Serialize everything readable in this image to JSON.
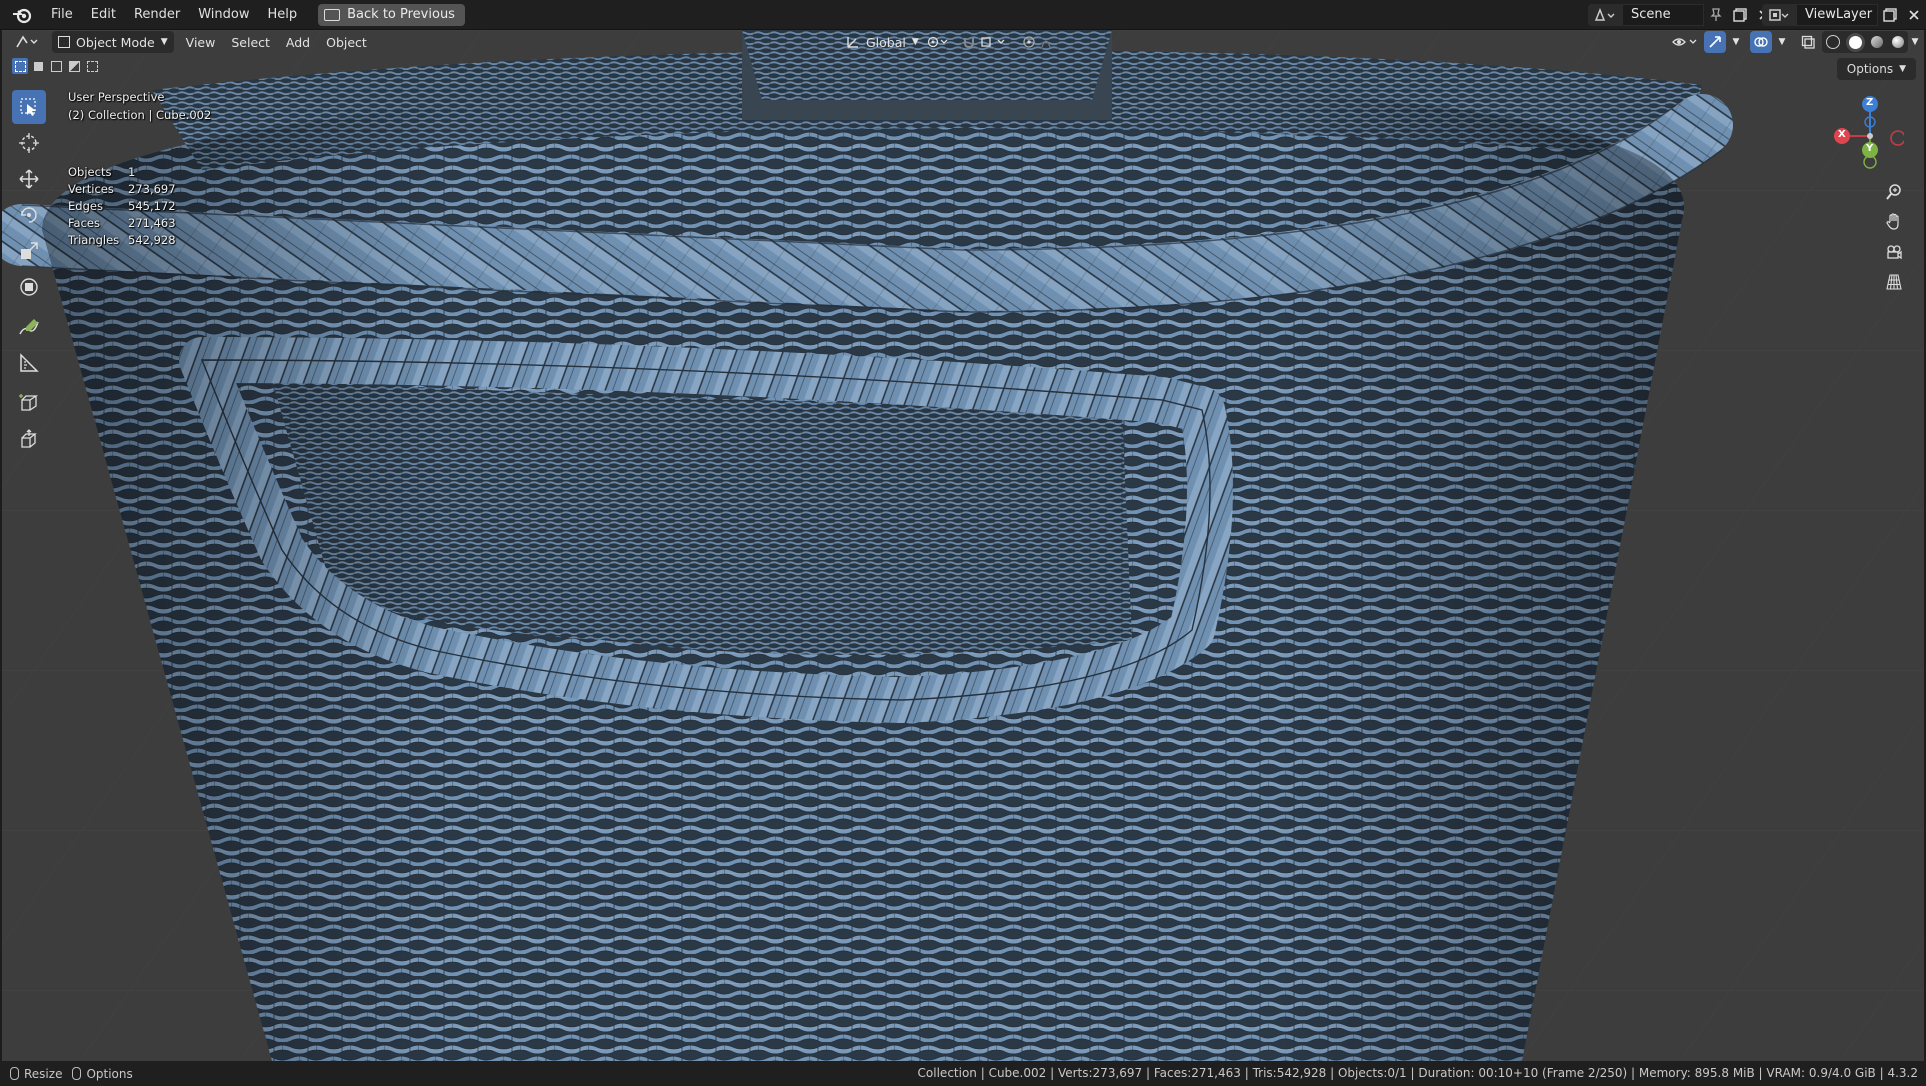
{
  "topbar": {
    "menus": [
      "File",
      "Edit",
      "Render",
      "Window",
      "Help"
    ],
    "back_label": "Back to Previous",
    "scene_name": "Scene",
    "view_layer_name": "ViewLayer"
  },
  "viewport_header": {
    "mode": "Object Mode",
    "menus": [
      "View",
      "Select",
      "Add",
      "Object"
    ],
    "orientation": "Global",
    "options_label": "Options"
  },
  "overlay": {
    "view_name": "User Perspective",
    "collection_line": "(2) Collection | Cube.002",
    "stats": [
      {
        "label": "Objects",
        "value": "1"
      },
      {
        "label": "Vertices",
        "value": "273,697"
      },
      {
        "label": "Edges",
        "value": "545,172"
      },
      {
        "label": "Faces",
        "value": "271,463"
      },
      {
        "label": "Triangles",
        "value": "542,928"
      }
    ]
  },
  "gizmo": {
    "x": "X",
    "y": "Y",
    "z": "Z"
  },
  "statusbar": {
    "left_resize": "Resize",
    "left_options": "Options",
    "right_text": "Collection | Cube.002 | Verts:273,697 | Faces:271,463 | Tris:542,928 | Objects:0/1 | Duration: 00:10+10 (Frame 2/250) | Memory: 895.8 MiB | VRAM: 0.9/4.0 GiB | 4.3.2"
  },
  "colors": {
    "accent": "#4772b3",
    "basket": "#6f8fae",
    "basket_dark": "#2d3a47",
    "viewport_bg": "#3d3d3d"
  },
  "icons": [
    "blender-logo-icon",
    "select-box-icon",
    "cursor-icon",
    "move-icon",
    "rotate-icon",
    "scale-icon",
    "transform-icon",
    "annotate-icon",
    "measure-icon",
    "add-cube-icon",
    "extrude-icon",
    "zoom-icon",
    "pan-hand-icon",
    "camera-icon",
    "grid-icon"
  ]
}
